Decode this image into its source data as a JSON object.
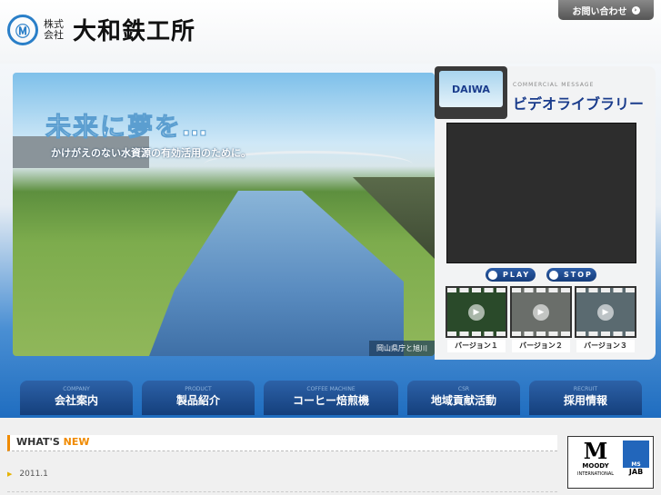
{
  "header": {
    "logo_prefix": "株式 会社",
    "company_name": "大和鉄工所",
    "contact_button": "お問い合わせ"
  },
  "hero": {
    "headline": "未来に夢を…",
    "subline": "かけがえのない水資源の有効活用のために。",
    "caption": "岡山県庁と旭川"
  },
  "video": {
    "tv_label": "DAIWA",
    "kicker": "COMMERCIAL MESSAGE",
    "title": "ビデオライブラリー",
    "play": "PLAY",
    "stop": "STOP",
    "versions": [
      "バージョン１",
      "バージョン２",
      "バージョン３"
    ]
  },
  "nav": [
    {
      "en": "COMPANY",
      "ja": "会社案内"
    },
    {
      "en": "PRODUCT",
      "ja": "製品紹介"
    },
    {
      "en": "COFFEE MACHINE",
      "ja": "コーヒー焙煎機"
    },
    {
      "en": "CSR",
      "ja": "地域貢献活動"
    },
    {
      "en": "RECRUIT",
      "ja": "採用情報"
    }
  ],
  "news": {
    "title_a": "WHAT'S",
    "title_b": "NEW",
    "items": [
      {
        "date": "2011.1"
      }
    ]
  },
  "cert": {
    "moody": "MOODY",
    "intl": "INTERNATIONAL",
    "jab": "JAB",
    "ms": "MS"
  }
}
